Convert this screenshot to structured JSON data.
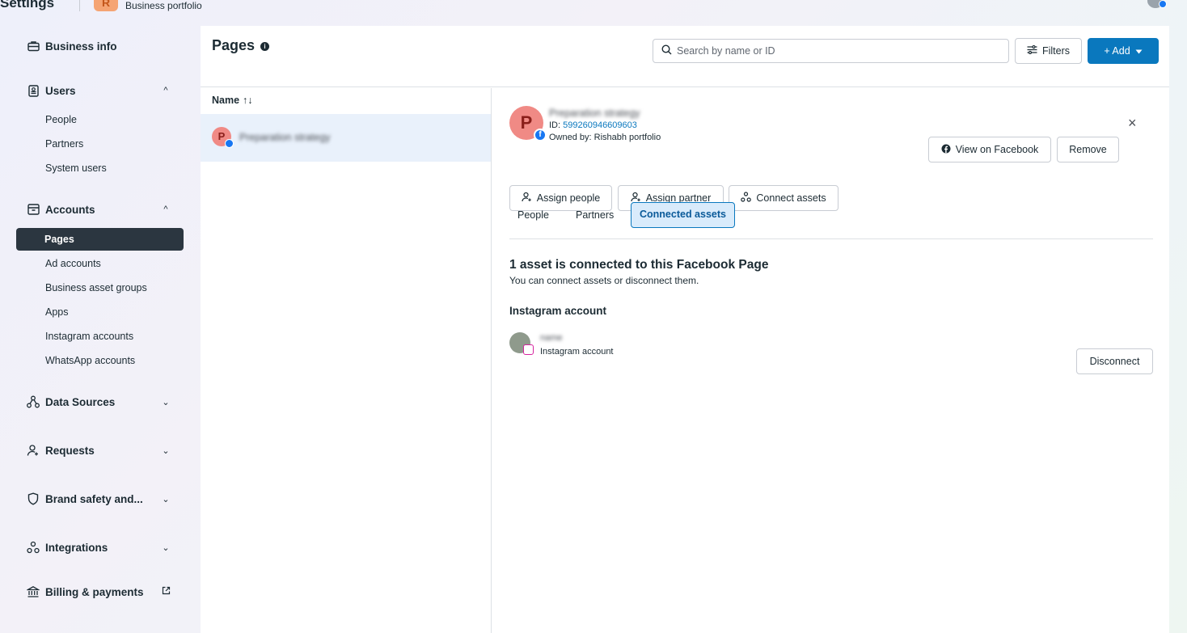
{
  "topbar": {
    "app_title": "Settings",
    "portfolio_initial": "R",
    "portfolio_label": "Business portfolio"
  },
  "sidebar": {
    "business_info": "Business info",
    "users": {
      "label": "Users",
      "items": [
        "People",
        "Partners",
        "System users"
      ]
    },
    "accounts": {
      "label": "Accounts",
      "active": "Pages",
      "items": [
        "Ad accounts",
        "Business asset groups",
        "Apps",
        "Instagram accounts",
        "WhatsApp accounts"
      ]
    },
    "data_sources": "Data Sources",
    "requests": "Requests",
    "brand_safety": "Brand safety and...",
    "integrations": "Integrations",
    "billing": "Billing & payments"
  },
  "main": {
    "title": "Pages",
    "search_placeholder": "Search by name or ID",
    "filters_label": "Filters",
    "add_label": "+ Add",
    "list": {
      "column_name": "Name",
      "sort_glyph": "↑↓",
      "rows": [
        {
          "initial": "P",
          "name": "Preparation strategy"
        }
      ]
    }
  },
  "detail": {
    "initial": "P",
    "name": "Preparation strategy",
    "id_label": "ID:",
    "id_value": "599260946609603",
    "owner": "Owned by: Rishabh portfolio",
    "view_on_facebook": "View on Facebook",
    "remove": "Remove",
    "close": "×",
    "assign_people": "Assign people",
    "assign_partner": "Assign partner",
    "connect_assets": "Connect assets",
    "tabs": [
      "People",
      "Partners",
      "Connected assets"
    ],
    "active_tab": "Connected assets",
    "section_title": "1 asset is connected to this Facebook Page",
    "section_sub": "You can connect assets or disconnect them.",
    "instagram_title": "Instagram account",
    "instagram_name": "name",
    "instagram_type": "Instagram account",
    "disconnect": "Disconnect"
  },
  "colors": {
    "accent": "#0a78be",
    "sidebar_active": "#2b3640",
    "avatar_bg": "#f08a85",
    "facebook_blue": "#1877f2"
  }
}
